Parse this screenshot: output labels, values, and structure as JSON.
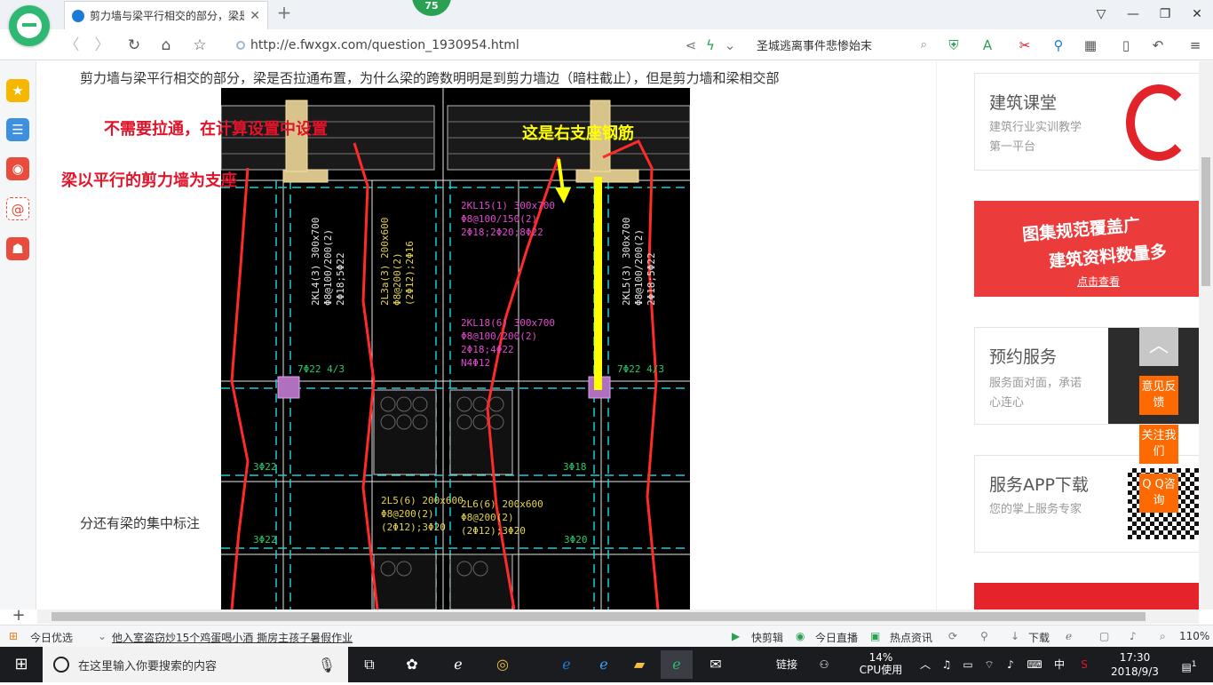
{
  "browser": {
    "badge": "75",
    "tab_title": "剪力墙与梁平行相交的部分，梁是",
    "url": "http://e.fwxgx.com/question_1930954.html",
    "search_text": "圣城逃离事件悲惨始末"
  },
  "page": {
    "question_line1": "剪力墙与梁平行相交的部分，梁是否拉通布置，为什么梁的跨数明明是到剪力墙边（暗柱截止），但是剪力墙和梁相交部",
    "question_line2": "分还有梁的集中标注",
    "annotation_red_1": "不需要拉通，在计算设置中设置",
    "annotation_red_2": "梁以平行的剪力墙为支座",
    "annotation_yellow": "这是右支座钢筋",
    "cad_labels": {
      "a": "2KL15(1) 300x700",
      "b": "Φ8@100/150(2)",
      "c": "2Φ18;2Φ20;8Φ22",
      "d": "2KL18(6) 300x700",
      "e": "Φ8@100/200(2)",
      "f": "2Φ18;4Φ22",
      "g": "N4Φ12",
      "h": "2L5(6) 200x600",
      "i": "Φ8@200(2)",
      "j": "(2Φ12);3Φ20",
      "k": "2L6(6) 200x600",
      "l": "Φ8@200(2)",
      "m": "(2Φ12);3Φ20",
      "n": "2KL4(3) 300x700",
      "o": "Φ8@100/200(2)",
      "p": "2Φ18;5Φ22",
      "q": "2L3a(3) 200x600",
      "r": "Φ8@200(2)",
      "s": "(2Φ12);2Φ16",
      "t": "2KL5(3) 300x700",
      "u": "Φ8@100/200(2)",
      "v": "2Φ18;5Φ22",
      "w": "7Φ22 4/3",
      "x": "3Φ18",
      "y": "3Φ22",
      "z": "3Φ20"
    }
  },
  "right": {
    "card1_title": "建筑课堂",
    "card1_sub": "建筑行业实训教学第一平台",
    "ad_line1": "图集规范覆盖广",
    "ad_line2": "建筑资料数量多",
    "ad_cta": "点击查看",
    "card2_title": "预约服务",
    "card2_sub": "服务面对面，承诺心连心",
    "card3_title": "服务APP下载",
    "card3_sub": "您的掌上服务专家"
  },
  "float": {
    "feedback": "意见反馈",
    "follow": "关注我们",
    "qq": "Q Q咨询"
  },
  "status": {
    "today": "今日优选",
    "news": "他入室盗窃炒15个鸡蛋喝小酒 撕房主孩子暑假作业",
    "clip": "快剪辑",
    "live": "今日直播",
    "hot": "热点资讯",
    "download": "下载",
    "zoom": "110%"
  },
  "taskbar": {
    "search_placeholder": "在这里输入你要搜索的内容",
    "link": "链接",
    "cpu_pct": "14%",
    "cpu_label": "CPU使用",
    "ime": "中",
    "time": "17:30",
    "date": "2018/9/3",
    "notif_count": "1"
  }
}
